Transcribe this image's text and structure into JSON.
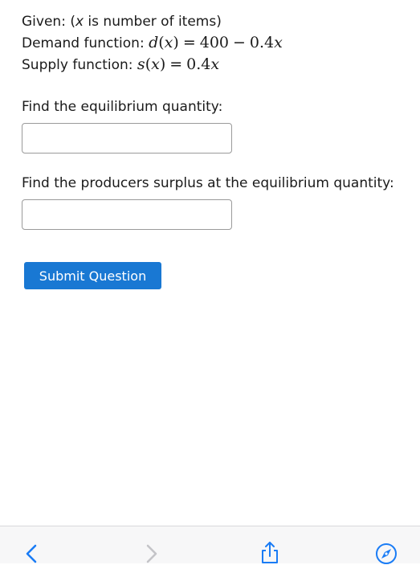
{
  "given": {
    "label": "Given: (",
    "variable": "x",
    "note": " is number of items)"
  },
  "demand": {
    "label": "Demand function: ",
    "func": "d",
    "var": "x",
    "rhs_const": "400",
    "minus": "−",
    "rhs_coef": "0.4"
  },
  "supply": {
    "label": "Supply function: ",
    "func": "s",
    "var": "x",
    "rhs_coef": "0.4"
  },
  "questions": {
    "q1_prompt": "Find the equilibrium quantity:",
    "q1_value": "",
    "q2_prompt": "Find the producers surplus at the equilibrium quantity:",
    "q2_value": ""
  },
  "submit_label": "Submit Question",
  "toolbar": {
    "icons": [
      "back-icon",
      "forward-icon",
      "share-icon",
      "compass-icon"
    ],
    "active_color": "#1a7cf5",
    "disabled_color": "#c4c4c8"
  },
  "colors": {
    "button_bg": "#1978d3",
    "button_text": "#ffffff",
    "text": "#1a1a1a",
    "input_border": "#9a9a9a"
  }
}
